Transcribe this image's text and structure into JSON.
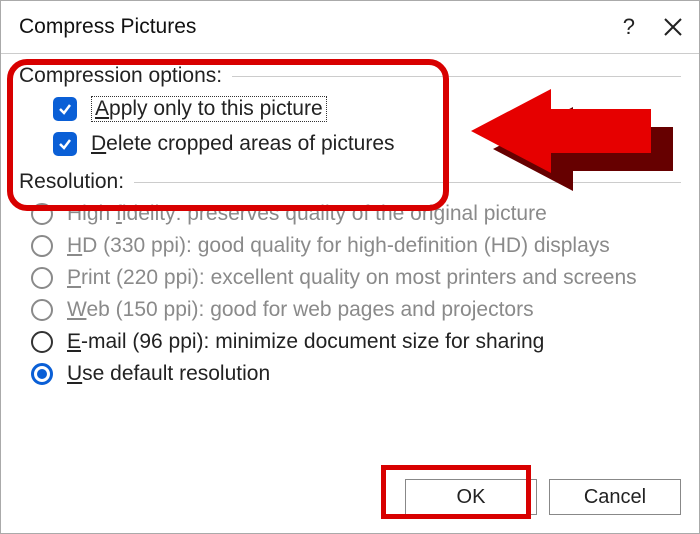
{
  "dialog": {
    "title": "Compress Pictures"
  },
  "sections": {
    "compression_header": "Compression options:",
    "resolution_header": "Resolution:"
  },
  "compression_options": {
    "apply_only": {
      "mnemonic": "A",
      "rest": "pply only to this picture"
    },
    "delete_cropped": {
      "mnemonic": "D",
      "rest": "elete cropped areas of pictures"
    }
  },
  "resolution_options": [
    {
      "mnemonic": "f",
      "pre": "High ",
      "post": "idelity: preserves quality of the original picture",
      "state": "disabled"
    },
    {
      "mnemonic": "H",
      "pre": "",
      "post": "D (330 ppi): good quality for high-definition (HD) displays",
      "state": "disabled"
    },
    {
      "mnemonic": "P",
      "pre": "",
      "post": "rint (220 ppi): excellent quality on most printers and screens",
      "state": "disabled"
    },
    {
      "mnemonic": "W",
      "pre": "",
      "post": "eb (150 ppi): good for web pages and projectors",
      "state": "disabled"
    },
    {
      "mnemonic": "E",
      "pre": "",
      "post": "-mail (96 ppi): minimize document size for sharing",
      "state": "enabled-unselected"
    },
    {
      "mnemonic": "U",
      "pre": "",
      "post": "se default resolution",
      "state": "selected"
    }
  ],
  "buttons": {
    "ok": "OK",
    "cancel": "Cancel"
  }
}
